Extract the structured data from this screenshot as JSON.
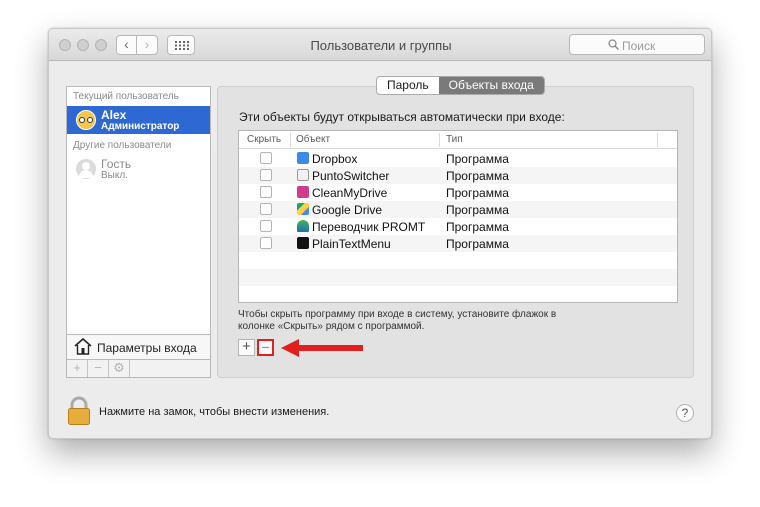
{
  "window": {
    "title": "Пользователи и группы"
  },
  "search": {
    "placeholder": "Поиск"
  },
  "sidebar": {
    "current_section": "Текущий пользователь",
    "other_section": "Другие пользователи",
    "current_user": {
      "name": "Alex",
      "role": "Администратор"
    },
    "guest_user": {
      "name": "Гость",
      "status": "Выкл."
    },
    "login_options_label": "Параметры входа",
    "buttons": [
      "+",
      "−",
      "⚙"
    ]
  },
  "tabs": [
    {
      "label": "Пароль",
      "active": false
    },
    {
      "label": "Объекты входа",
      "active": true
    }
  ],
  "login_items": {
    "heading": "Эти объекты будут открываться автоматически при входе:",
    "columns": {
      "hide": "Скрыть",
      "object": "Объект",
      "type": "Тип"
    },
    "rows": [
      {
        "name": "Dropbox",
        "type": "Программа",
        "icon": "dropbox-icon"
      },
      {
        "name": "PuntoSwitcher",
        "type": "Программа",
        "icon": "puntoswitcher-icon"
      },
      {
        "name": "CleanMyDrive",
        "type": "Программа",
        "icon": "cleanmydrive-icon"
      },
      {
        "name": "Google Drive",
        "type": "Программа",
        "icon": "google-drive-icon"
      },
      {
        "name": "Переводчик PROMT",
        "type": "Программа",
        "icon": "promt-icon"
      },
      {
        "name": "PlainTextMenu",
        "type": "Программа",
        "icon": "plaintextmenu-icon"
      }
    ],
    "hint": "Чтобы скрыть программу при входе в систему, установите флажок в колонке «Скрыть» рядом с программой.",
    "add_label": "+",
    "remove_label": "−"
  },
  "footer": {
    "lock_text": "Нажмите на замок, чтобы внести изменения.",
    "help_label": "?"
  },
  "colors": {
    "selection": "#2e69d3",
    "highlight_annotation": "#e02020"
  }
}
